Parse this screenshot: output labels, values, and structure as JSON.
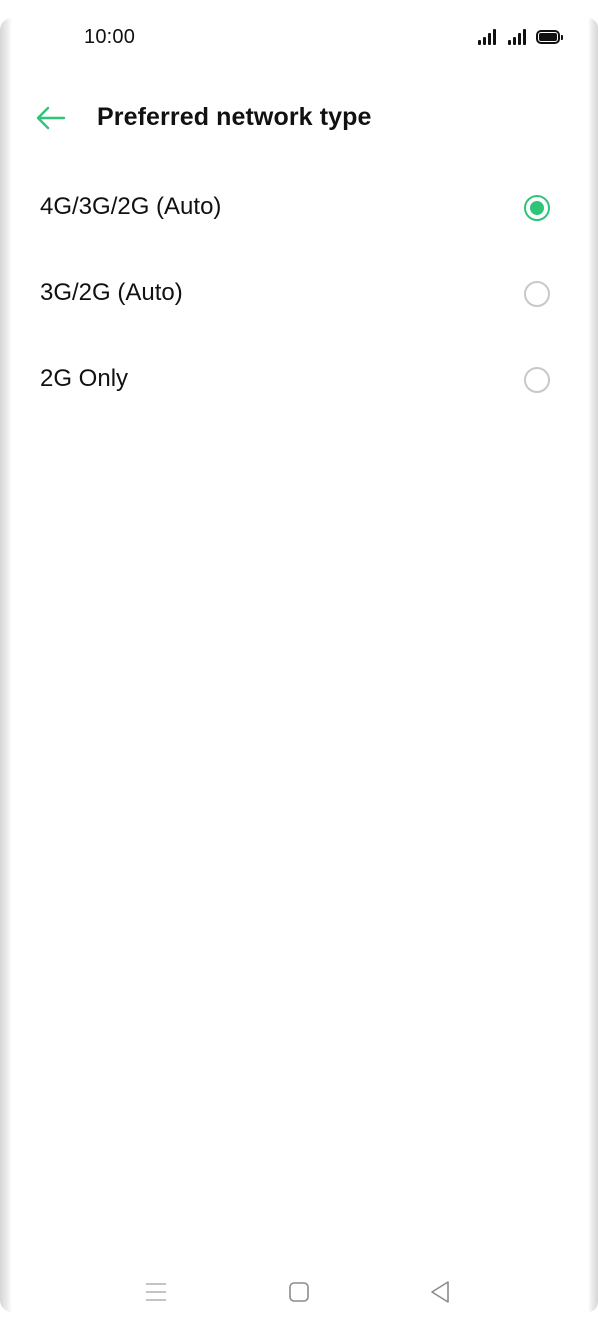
{
  "status_bar": {
    "time": "10:00",
    "signal_icons": [
      "signal-icon",
      "signal-icon"
    ],
    "battery_icon": "battery-icon"
  },
  "header": {
    "back_icon": "arrow-left-icon",
    "title": "Preferred network type"
  },
  "options": [
    {
      "label": "4G/3G/2G (Auto)",
      "selected": true
    },
    {
      "label": "3G/2G (Auto)",
      "selected": false
    },
    {
      "label": "2G Only",
      "selected": false
    }
  ],
  "nav_bar": {
    "menu_icon": "menu-icon",
    "home_icon": "home-square-icon",
    "back_icon": "back-triangle-icon"
  },
  "colors": {
    "accent": "#2ec47a",
    "radio_unselected": "#c8c8c8",
    "text": "#111111",
    "nav_icons": "#b0b0b0"
  }
}
